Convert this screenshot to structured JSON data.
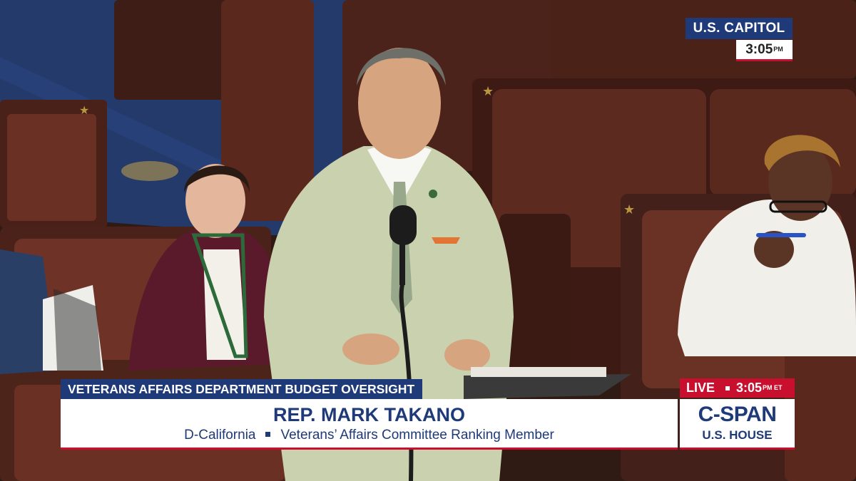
{
  "broadcast": {
    "location_badge": "U.S. CAPITOL",
    "badge_time": "3:05",
    "badge_time_suffix": "PM",
    "live_label": "LIVE",
    "live_time": "3:05",
    "live_time_suffix": "PM ET",
    "network_logo": "C-SPAN",
    "network_channel": "U.S. HOUSE"
  },
  "lower_third": {
    "topic": "VETERANS AFFAIRS DEPARTMENT BUDGET OVERSIGHT",
    "speaker_name": "REP. MARK TAKANO",
    "party_state": "D-California",
    "role": "Veterans’ Affairs Committee Ranking Member"
  },
  "colors": {
    "cspan_blue": "#1f3a78",
    "cspan_red": "#c8102e",
    "panel_white": "#ffffff"
  }
}
